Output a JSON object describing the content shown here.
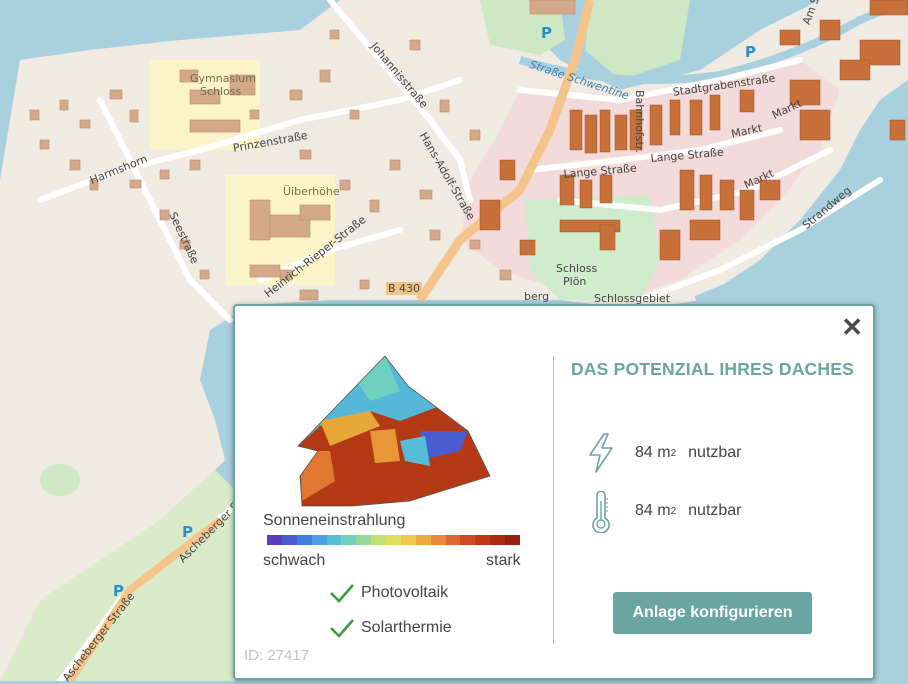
{
  "map": {
    "labels": {
      "harmshorn": "Harmshorn",
      "prinzenstrasse": "Prinzenstraße",
      "johannisstrasse": "Johannisstraße",
      "hans_adolf_strasse": "Hans-Adolf-Straße",
      "seestrasse": "Seestraße",
      "heinrich_rieper_strasse": "Heinrich-Rieper-Straße",
      "gymnasium": "Gymnasium",
      "gymnasium_sub": "Schloss",
      "uberhohe": "Üiberhöhe",
      "b430": "B 430",
      "stadtgrabenstrasse": "Stadtgrabenstraße",
      "lange_strasse_1": "Lange Straße",
      "lange_strasse_2": "Lange Straße",
      "markt_1": "Markt",
      "markt_2": "Markt",
      "markt_3": "Markt",
      "strandweg": "Strandweg",
      "schloss": "Schloss",
      "schloss_sub": "Plön",
      "schlossgebiet": "Schlossgebiet",
      "strasse_schwentine": "Straße Schwentine",
      "berg": "berg",
      "ascheberger_1": "Ascheberger Straße",
      "ascheberger_2": "Ascheberger Straße",
      "am_strasse": "Am Str",
      "bahnhofstrasse": "Bahnhofstr."
    },
    "parking": "P"
  },
  "popup": {
    "close_symbol": "✕",
    "legend": {
      "title": "Sonneneinstrahlung",
      "low": "schwach",
      "high": "stark"
    },
    "checks": [
      "Photovoltaik",
      "Solarthermie"
    ],
    "id_text": "ID: 27417",
    "heading": "DAS POTENZIAL IHRES DACHES",
    "stats": [
      {
        "icon": "lightning-icon",
        "value": "84",
        "unit": "m",
        "exp": "2",
        "label": "nutzbar"
      },
      {
        "icon": "thermometer-icon",
        "value": "84",
        "unit": "m",
        "exp": "2",
        "label": "nutzbar"
      }
    ],
    "button": "Anlage konfigurieren"
  },
  "colors": {
    "accent": "#6aa5a2",
    "check": "#3a9e3a",
    "scale": [
      "#5b3fb8",
      "#4a5bd0",
      "#3f7fe0",
      "#4aa0e0",
      "#56bdd8",
      "#70d0c0",
      "#98d898",
      "#c0e070",
      "#e0e060",
      "#f0c850",
      "#f0a840",
      "#e88838",
      "#e06830",
      "#d04c20",
      "#c03818",
      "#a82c10",
      "#982010"
    ]
  }
}
